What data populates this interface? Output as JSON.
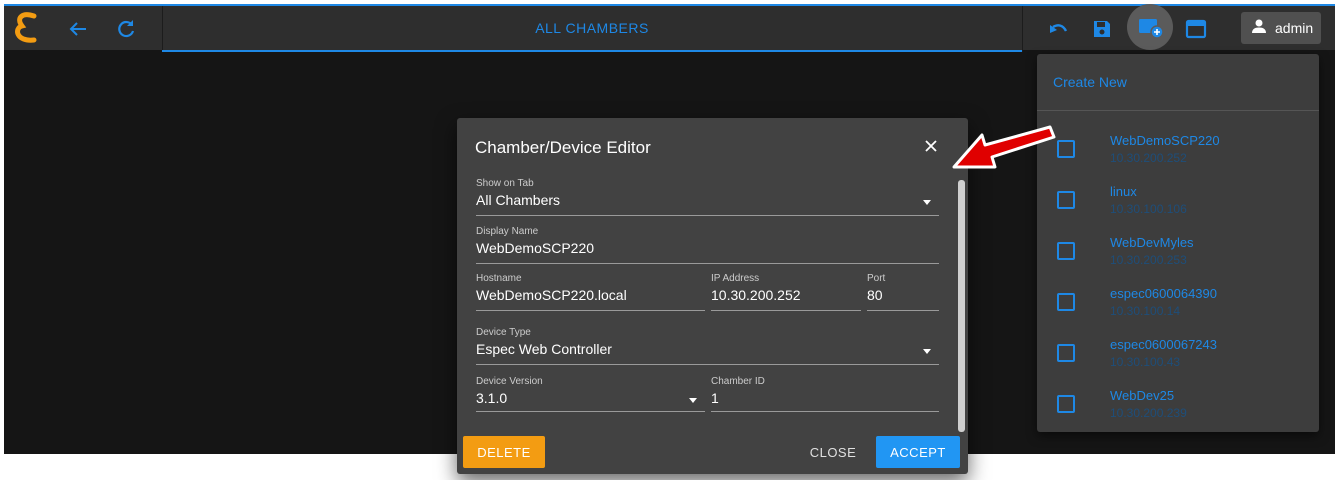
{
  "topbar": {
    "tab_label": "ALL CHAMBERS",
    "user_label": "admin",
    "icons": [
      "logo-icon",
      "back-arrow-icon",
      "refresh-icon",
      "undo-icon",
      "save-icon",
      "add-window-icon",
      "window-icon",
      "user-icon"
    ]
  },
  "dropdown": {
    "create_new": "Create New",
    "items": [
      {
        "name": "WebDemoSCP220",
        "ip": "10.30.200.252"
      },
      {
        "name": "linux",
        "ip": "10.30.100.106"
      },
      {
        "name": "WebDevMyles",
        "ip": "10.30.200.253"
      },
      {
        "name": "espec0600064390",
        "ip": "10.30.100.14"
      },
      {
        "name": "espec0600067243",
        "ip": "10.30.100.43"
      },
      {
        "name": "WebDev25",
        "ip": "10.30.200.239"
      }
    ]
  },
  "dialog": {
    "title": "Chamber/Device Editor",
    "show_on_tab": {
      "label": "Show on Tab",
      "value": "All Chambers"
    },
    "display_name": {
      "label": "Display Name",
      "value": "WebDemoSCP220"
    },
    "hostname": {
      "label": "Hostname",
      "value": "WebDemoSCP220.local"
    },
    "ip_address": {
      "label": "IP Address",
      "value": "10.30.200.252"
    },
    "port": {
      "label": "Port",
      "value": "80"
    },
    "device_type": {
      "label": "Device Type",
      "value": "Espec Web Controller"
    },
    "device_version": {
      "label": "Device Version",
      "value": "3.1.0"
    },
    "chamber_id": {
      "label": "Chamber ID",
      "value": "1"
    },
    "delete_label": "DELETE",
    "close_label": "CLOSE",
    "accept_label": "ACCEPT"
  },
  "colors": {
    "accent": "#1e88e5",
    "delete": "#f39c12",
    "accept": "#2196f3",
    "annotation_arrow": "#e00000"
  }
}
